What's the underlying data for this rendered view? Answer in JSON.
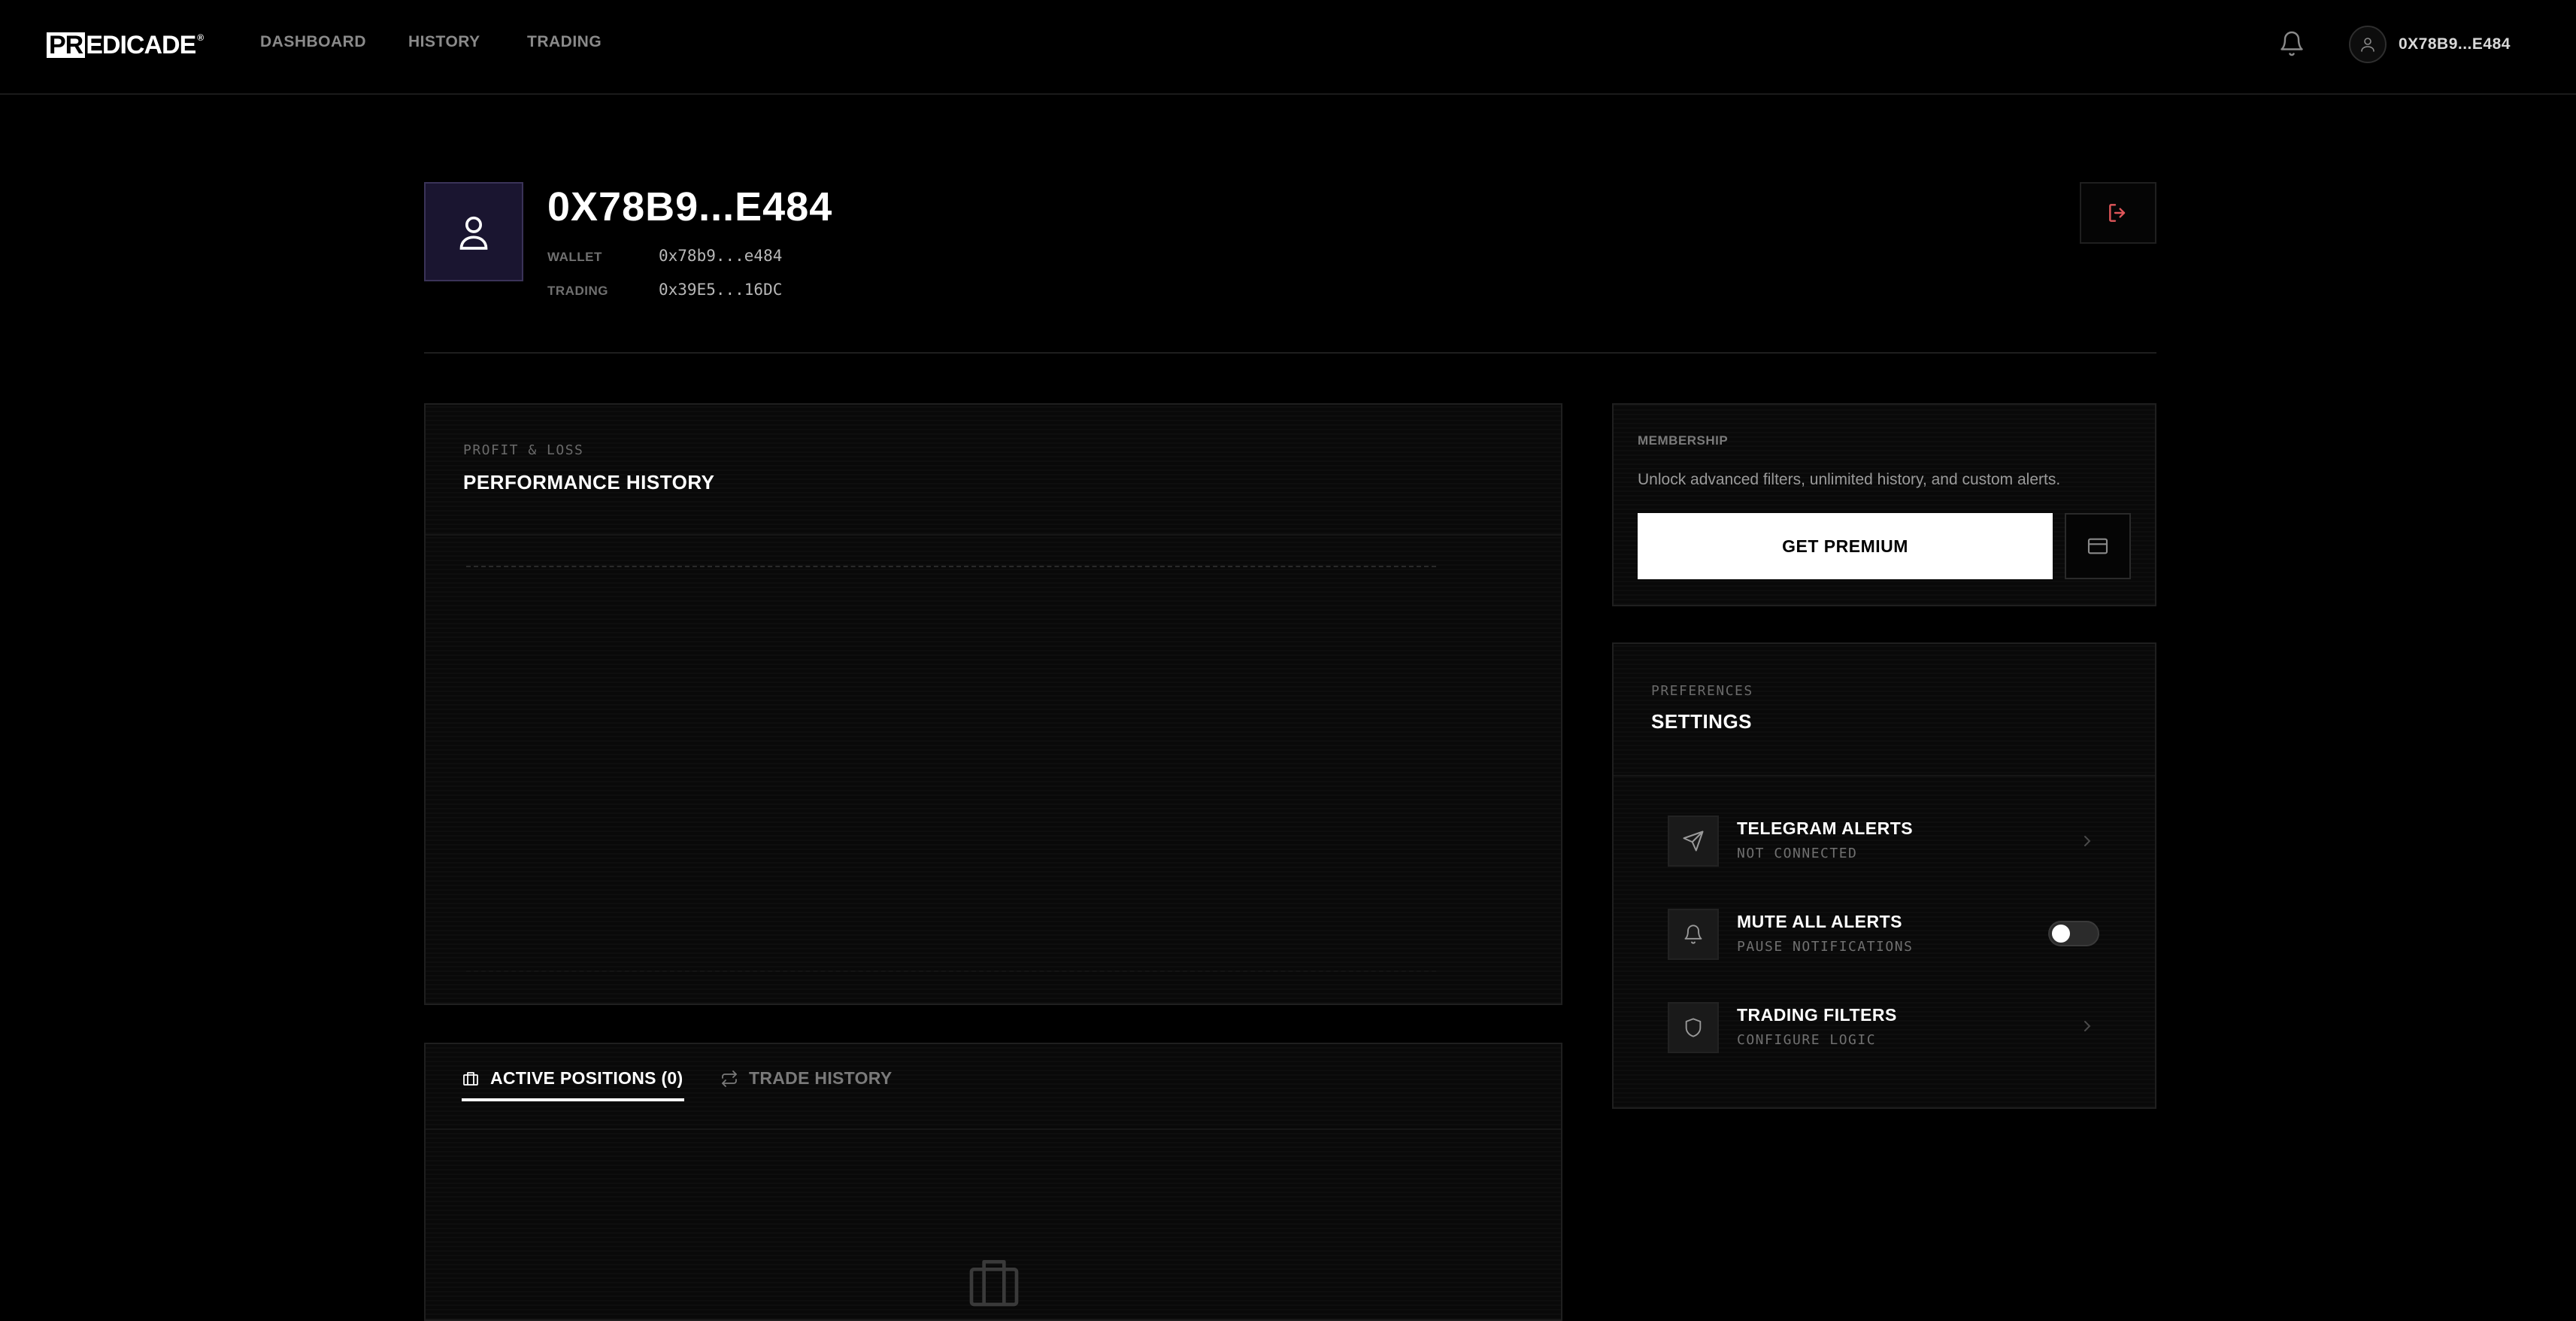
{
  "header": {
    "logo_boxed": "PR",
    "logo_rest": "EDICADE",
    "logo_mark": "®",
    "nav": [
      "DASHBOARD",
      "HISTORY",
      "TRADING"
    ],
    "user_label": "0X78B9...E484",
    "icons": {
      "notifications": "bell-icon",
      "user": "user-icon"
    }
  },
  "profile": {
    "name": "0X78B9...E484",
    "wallet_label": "WALLET",
    "wallet_value": "0x78b9...e484",
    "trading_label": "TRADING",
    "trading_value": "0x39E5...16DC",
    "logout_icon": "logout-icon"
  },
  "performance": {
    "eyebrow": "PROFIT & LOSS",
    "title": "PERFORMANCE HISTORY"
  },
  "tabs": [
    {
      "label": "ACTIVE POSITIONS (0)",
      "icon": "briefcase-icon",
      "active": true
    },
    {
      "label": "TRADE HISTORY",
      "icon": "repeat-icon",
      "active": false
    }
  ],
  "membership": {
    "eyebrow": "MEMBERSHIP",
    "text": "Unlock advanced filters, unlimited history, and custom alerts.",
    "button_label": "GET PREMIUM",
    "card_icon": "credit-card-icon"
  },
  "settings": {
    "eyebrow": "PREFERENCES",
    "title": "SETTINGS",
    "items": [
      {
        "title": "TELEGRAM ALERTS",
        "subtitle": "NOT CONNECTED",
        "icon": "send-icon",
        "control": "chevron"
      },
      {
        "title": "MUTE ALL ALERTS",
        "subtitle": "PAUSE NOTIFICATIONS",
        "icon": "bell-icon",
        "control": "toggle",
        "toggle_on": false
      },
      {
        "title": "TRADING FILTERS",
        "subtitle": "CONFIGURE LOGIC",
        "icon": "shield-icon",
        "control": "chevron"
      }
    ]
  },
  "colors": {
    "background": "#000000",
    "panel": "#090909",
    "avatar_bg": "#1a1530",
    "logout_accent": "#e0565a",
    "button_bg": "#ffffff"
  }
}
